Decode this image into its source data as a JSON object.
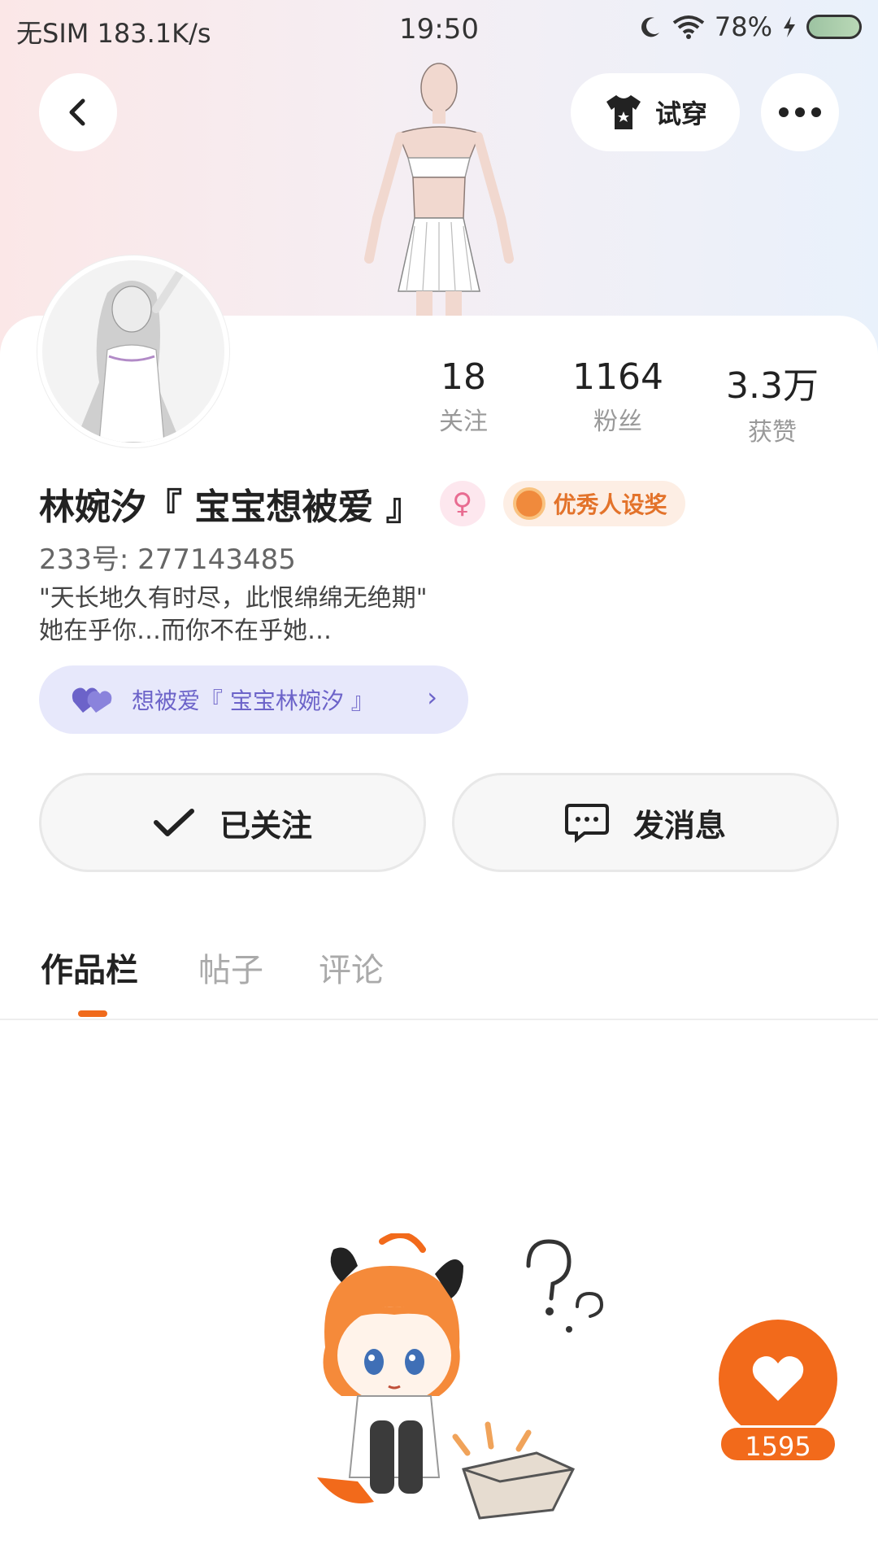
{
  "status_bar": {
    "carrier": "无SIM",
    "speed": "183.1K/s",
    "time": "19:50",
    "battery": "78%",
    "icons": [
      "moon-icon",
      "wifi-icon",
      "charging-icon",
      "battery-icon"
    ]
  },
  "header": {
    "back_icon": "chevron-left-icon",
    "try_on_label": "试穿",
    "try_on_icon": "tshirt-icon",
    "more_icon": "more-horizontal-icon"
  },
  "profile": {
    "name": "林婉汐『 宝宝想被爱 』",
    "gender_icon": "female-icon",
    "award_label": "优秀人设奖",
    "uid": "233号:  277143485",
    "bio_line1": "\"天长地久有时尽，此恨绵绵无绝期\"",
    "bio_line2": "她在乎你…而你不在乎她…",
    "cp_label": "想被爱『 宝宝林婉汐 』",
    "stats": [
      {
        "value": "18",
        "label": "关注"
      },
      {
        "value": "1164",
        "label": "粉丝"
      },
      {
        "value": "3.3万",
        "label": "获赞"
      }
    ]
  },
  "actions": {
    "follow_label": "已关注",
    "message_label": "发消息"
  },
  "tabs": [
    {
      "label": "作品栏",
      "active": true
    },
    {
      "label": "帖子",
      "active": false
    },
    {
      "label": "评论",
      "active": false
    }
  ],
  "like_fab": {
    "count": "1595",
    "icon": "heart-icon"
  },
  "colors": {
    "accent": "#f26a1b",
    "cp_pill_bg": "#e7e8fb",
    "cp_text": "#6c63c9"
  }
}
